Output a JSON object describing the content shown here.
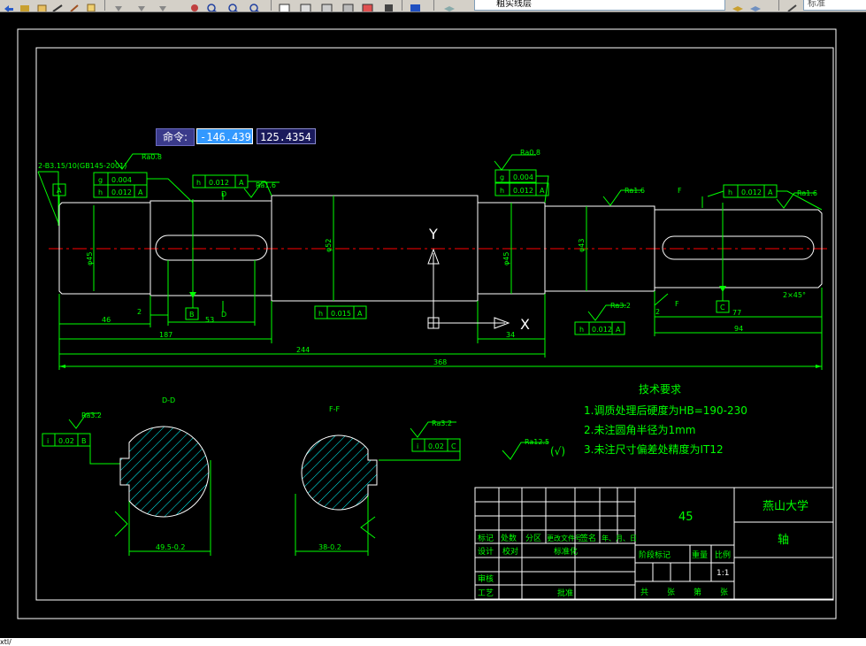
{
  "toolbar": {
    "layer_name": "粗实线层",
    "text_style": "标准"
  },
  "command": {
    "label": "命令:",
    "x_value": "-146.439",
    "y_value": "125.4354"
  },
  "ucs": {
    "y": "Y",
    "x": "X"
  },
  "drawing": {
    "thread_note": "2-B3.15/10(GB145-2001)",
    "rough_ra08": "Ra0.8",
    "rough_ra16": "Ra1.6",
    "rough_ra32": "Ra3.2",
    "rough_ra125": "Ra12.5",
    "tol_g_0004": "0.004",
    "tol_h_0012": "0.012",
    "tol_h_0015": "0.015",
    "tol_i_002": "0.02",
    "sym_g": "g",
    "sym_h": "h",
    "sym_i": "i",
    "datum_a": "A",
    "datum_b": "B",
    "datum_c": "C",
    "sec_d": "D",
    "sec_f": "F",
    "dim_46": "46",
    "dim_2": "2",
    "dim_53": "53",
    "dim_187": "187",
    "dim_244": "244",
    "dim_368": "368",
    "dim_34": "34",
    "dim_77": "77",
    "dim_94": "94",
    "chamfer": "2×45°",
    "dia_phi": "φ52",
    "dia_phi2": "φ43",
    "dia_dd": "φ45",
    "section_dd": "D-D",
    "section_ff": "F-F",
    "dim_sec1": "49.5-0.2",
    "dim_sec2": "38-0.2",
    "tech_title": "技术要求",
    "tech_1": "1.调质处理后硬度为HB=190-230",
    "tech_2": "2.未注圆角半径为1mm",
    "tech_3": "3.未注尺寸偏差处精度为IT12",
    "rough_general_paren": "(√)"
  },
  "title_block": {
    "material": "45",
    "school": "燕山大学",
    "part_name": "轴",
    "row_mark": "标记",
    "row_count": "处数",
    "row_zone": "分区",
    "row_doc": "更改文件号",
    "row_sign": "签名",
    "row_date": "年、月、日",
    "design": "设计",
    "std": "标准化",
    "review": "审核",
    "process": "工艺",
    "approve": "批准",
    "stage_mark": "阶段标记",
    "weight": "重量",
    "scale_label": "比例",
    "scale": "1:1",
    "total": "共",
    "sheets": "张",
    "page": "第",
    "sheet2": "张",
    "gu": "校对"
  },
  "status": {
    "text": "xtl/"
  },
  "colors": {
    "green": "#00ff00",
    "white": "#ffffff",
    "cyan": "#00ffff",
    "red": "#ff0000"
  }
}
